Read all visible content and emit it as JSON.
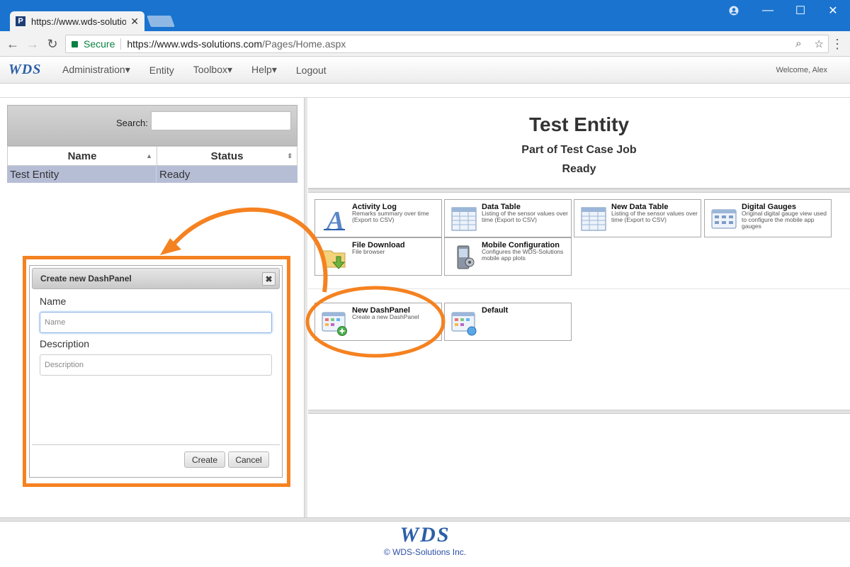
{
  "browser": {
    "tab_title": "https://www.wds-solutio",
    "tab_favicon": "P",
    "secure_label": "Secure",
    "url_host": "https://www.wds-solutions.com",
    "url_path": "/Pages/Home.aspx"
  },
  "app": {
    "logo": "WDS",
    "nav": [
      "Administration▾",
      "Entity",
      "Toolbox▾",
      "Help▾",
      "Logout"
    ],
    "welcome": "Welcome, Alex"
  },
  "grid": {
    "search_label": "Search:",
    "columns": [
      "Name",
      "Status"
    ],
    "rows": [
      {
        "name": "Test Entity",
        "status": "Ready"
      }
    ]
  },
  "dialog": {
    "title": "Create new DashPanel",
    "name_label": "Name",
    "name_placeholder": "Name",
    "desc_label": "Description",
    "desc_placeholder": "Description",
    "create": "Create",
    "cancel": "Cancel"
  },
  "entity": {
    "title": "Test Entity",
    "subtitle": "Part of Test Case Job",
    "status": "Ready"
  },
  "tiles": [
    {
      "name": "Activity Log",
      "desc": "Remarks summary over time (Export to CSV)",
      "icon": "activity-log-icon"
    },
    {
      "name": "Data Table",
      "desc": "Listing of the sensor values over time (Export to CSV)",
      "icon": "data-table-icon"
    },
    {
      "name": "New Data Table",
      "desc": "Listing of the sensor values over time (Export to CSV)",
      "icon": "data-table-icon"
    },
    {
      "name": "Digital Gauges",
      "desc": "Original digital gauge view used to configure the mobile app gauges",
      "icon": "gauges-icon"
    },
    {
      "name": "File Download",
      "desc": "File browser",
      "icon": "folder-download-icon"
    },
    {
      "name": "Mobile Configuration",
      "desc": "Configures the WDS-Solutions mobile app plots",
      "icon": "mobile-config-icon"
    }
  ],
  "dashpanels": [
    {
      "name": "New DashPanel",
      "desc": "Create a new DashPanel",
      "icon": "dashpanel-add-icon"
    },
    {
      "name": "Default",
      "desc": "",
      "icon": "dashpanel-icon"
    }
  ],
  "footer": {
    "logo": "WDS",
    "copyright": "© WDS-Solutions Inc."
  },
  "colors": {
    "chrome_blue": "#1a74cf",
    "highlight_orange": "#f58220",
    "selected_row": "#b6bed6",
    "brand_blue": "#2b5fa8"
  }
}
